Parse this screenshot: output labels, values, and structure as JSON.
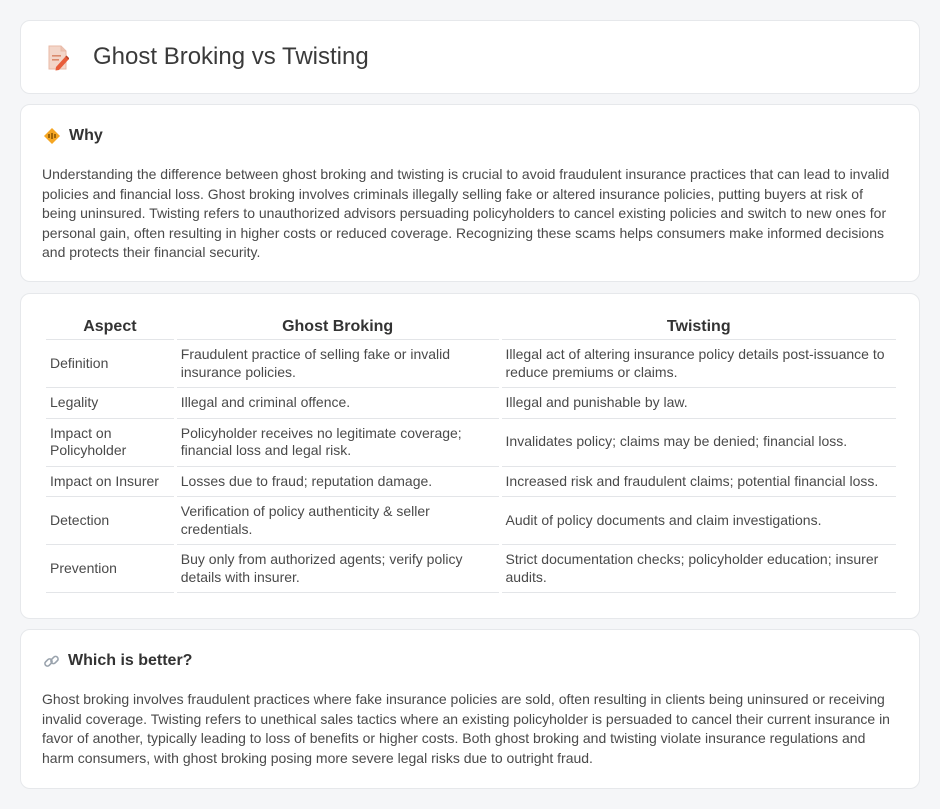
{
  "header": {
    "title": "Ghost Broking vs Twisting",
    "icon": "document-pencil-icon"
  },
  "why": {
    "heading": "Why",
    "icon": "warning-diamond-icon",
    "text": "Understanding the difference between ghost broking and twisting is crucial to avoid fraudulent insurance practices that can lead to invalid policies and financial loss. Ghost broking involves criminals illegally selling fake or altered insurance policies, putting buyers at risk of being uninsured. Twisting refers to unauthorized advisors persuading policyholders to cancel existing policies and switch to new ones for personal gain, often resulting in higher costs or reduced coverage. Recognizing these scams helps consumers make informed decisions and protects their financial security."
  },
  "comparison": {
    "headers": [
      "Aspect",
      "Ghost Broking",
      "Twisting"
    ],
    "rows": [
      [
        "Definition",
        "Fraudulent practice of selling fake or invalid insurance policies.",
        "Illegal act of altering insurance policy details post-issuance to reduce premiums or claims."
      ],
      [
        "Legality",
        "Illegal and criminal offence.",
        "Illegal and punishable by law."
      ],
      [
        "Impact on Policyholder",
        "Policyholder receives no legitimate coverage; financial loss and legal risk.",
        "Invalidates policy; claims may be denied; financial loss."
      ],
      [
        "Impact on Insurer",
        "Losses due to fraud; reputation damage.",
        "Increased risk and fraudulent claims; potential financial loss."
      ],
      [
        "Detection",
        "Verification of policy authenticity & seller credentials.",
        "Audit of policy documents and claim investigations."
      ],
      [
        "Prevention",
        "Buy only from authorized agents; verify policy details with insurer.",
        "Strict documentation checks; policyholder education; insurer audits."
      ]
    ]
  },
  "better": {
    "heading": "Which is better?",
    "icon": "link-icon",
    "text": "Ghost broking involves fraudulent practices where fake insurance policies are sold, often resulting in clients being uninsured or receiving invalid coverage. Twisting refers to unethical sales tactics where an existing policyholder is persuaded to cancel their current insurance in favor of another, typically leading to loss of benefits or higher costs. Both ghost broking and twisting violate insurance regulations and harm consumers, with ghost broking posing more severe legal risks due to outright fraud."
  }
}
